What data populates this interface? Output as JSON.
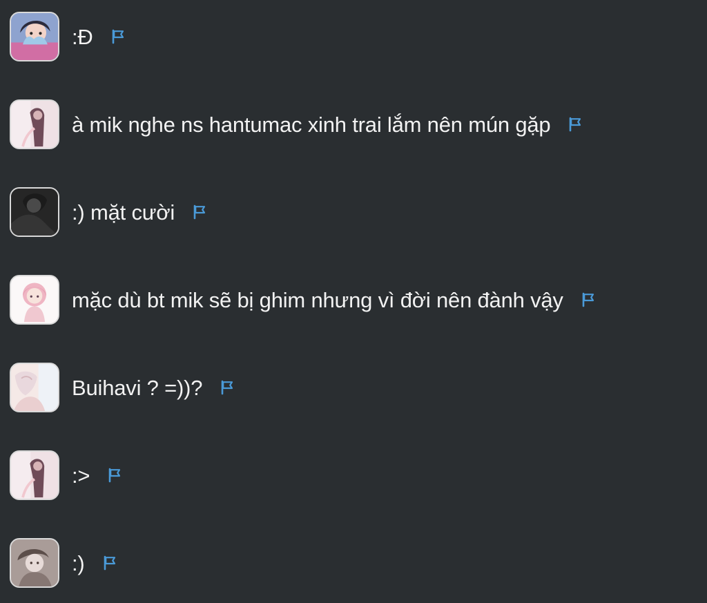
{
  "messages": [
    {
      "avatar": "anime-girl-colorful-avatar",
      "text": ":Đ"
    },
    {
      "avatar": "pink-figure-avatar",
      "text": "à mik nghe ns hantumac xinh trai lắm nên mún gặp"
    },
    {
      "avatar": "dark-monochrome-avatar",
      "text": ":) mặt cười"
    },
    {
      "avatar": "pink-haired-chibi-avatar",
      "text": "mặc dù bt mik sẽ bị ghim nhưng vì đời nên đành vậy"
    },
    {
      "avatar": "pastel-girl-avatar",
      "text": "Buihavi ? =))?"
    },
    {
      "avatar": "pink-figure-avatar",
      "text": ":>"
    },
    {
      "avatar": "sepia-girl-avatar",
      "text": ":)"
    }
  ],
  "icons": {
    "report": "flag-icon"
  },
  "colors": {
    "background": "#2a2e31",
    "text": "#f2f2f2",
    "flag": "#4a9ad8",
    "avatar_border": "#d9d9d9"
  }
}
